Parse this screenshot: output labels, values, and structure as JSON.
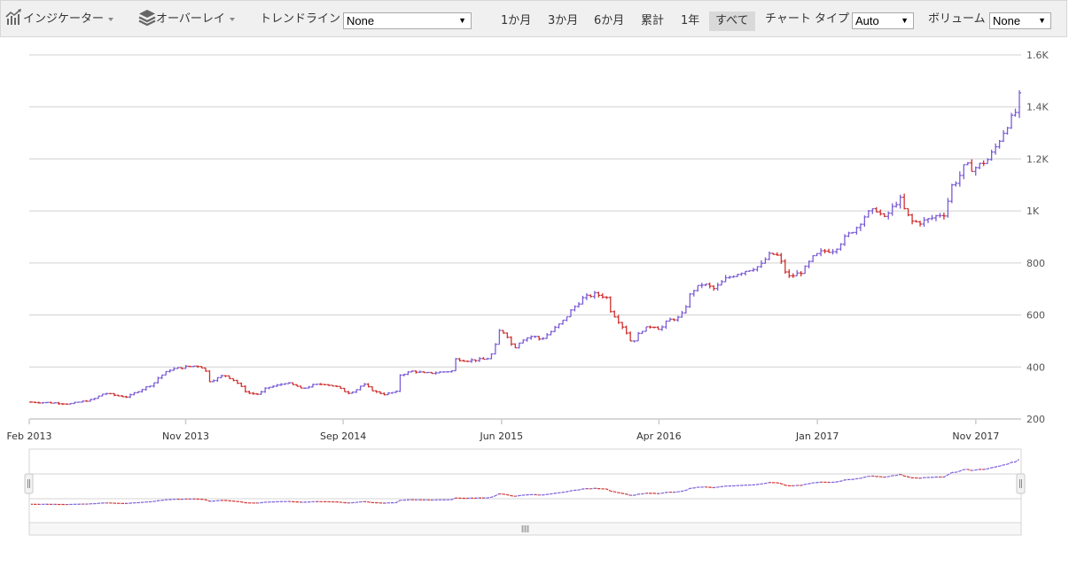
{
  "toolbar": {
    "indicator_label": "インジケーター",
    "overlay_label": "オーバーレイ",
    "trendline_label": "トレンドライン",
    "trendline_value": "None",
    "ranges": [
      {
        "label": "1か月",
        "active": false
      },
      {
        "label": "3か月",
        "active": false
      },
      {
        "label": "6か月",
        "active": false
      },
      {
        "label": "累計",
        "active": false
      },
      {
        "label": "1年",
        "active": false
      },
      {
        "label": "すべて",
        "active": true
      }
    ],
    "chart_type_label": "チャート タイプ",
    "chart_type_value": "Auto",
    "volume_label": "ボリューム",
    "volume_value": "None"
  },
  "colors": {
    "up": "#7b5cd6",
    "down": "#d03030",
    "grid": "#d0d0d0"
  },
  "chart_data": {
    "type": "ohlc",
    "title": "",
    "xlabel": "",
    "ylabel": "",
    "ylim": [
      200,
      1600
    ],
    "y_ticks": [
      {
        "value": 200,
        "label": "200"
      },
      {
        "value": 400,
        "label": "400"
      },
      {
        "value": 600,
        "label": "600"
      },
      {
        "value": 800,
        "label": "800"
      },
      {
        "value": 1000,
        "label": "1K"
      },
      {
        "value": 1200,
        "label": "1.2K"
      },
      {
        "value": 1400,
        "label": "1.4K"
      },
      {
        "value": 1600,
        "label": "1.6K"
      }
    ],
    "x_range": [
      "2013-02",
      "2018-01"
    ],
    "x_ticks": [
      {
        "pos": 0.0,
        "label": "Feb 2013"
      },
      {
        "pos": 0.158,
        "label": "Nov 2013"
      },
      {
        "pos": 0.317,
        "label": "Sep 2014"
      },
      {
        "pos": 0.477,
        "label": "Jun 2015"
      },
      {
        "pos": 0.636,
        "label": "Apr 2016"
      },
      {
        "pos": 0.796,
        "label": "Jan 2017"
      },
      {
        "pos": 0.956,
        "label": "Nov 2017"
      }
    ],
    "grid": true,
    "series_waypoints": [
      [
        0.0,
        265
      ],
      [
        0.03,
        262
      ],
      [
        0.05,
        258
      ],
      [
        0.08,
        275
      ],
      [
        0.095,
        300
      ],
      [
        0.11,
        290
      ],
      [
        0.125,
        285
      ],
      [
        0.14,
        310
      ],
      [
        0.158,
        335
      ],
      [
        0.165,
        360
      ],
      [
        0.18,
        390
      ],
      [
        0.2,
        400
      ],
      [
        0.215,
        405
      ],
      [
        0.225,
        395
      ],
      [
        0.23,
        345
      ],
      [
        0.24,
        355
      ],
      [
        0.25,
        370
      ],
      [
        0.265,
        345
      ],
      [
        0.28,
        300
      ],
      [
        0.295,
        295
      ],
      [
        0.305,
        320
      ],
      [
        0.32,
        330
      ],
      [
        0.33,
        340
      ],
      [
        0.345,
        325
      ],
      [
        0.35,
        315
      ],
      [
        0.365,
        330
      ],
      [
        0.38,
        335
      ],
      [
        0.395,
        325
      ],
      [
        0.41,
        300
      ],
      [
        0.42,
        310
      ],
      [
        0.43,
        335
      ],
      [
        0.445,
        305
      ],
      [
        0.458,
        295
      ],
      [
        0.465,
        300
      ],
      [
        0.475,
        305
      ],
      [
        0.478,
        370
      ],
      [
        0.495,
        385
      ],
      [
        0.51,
        375
      ],
      [
        0.53,
        380
      ],
      [
        0.545,
        385
      ],
      [
        0.55,
        430
      ],
      [
        0.565,
        425
      ],
      [
        0.59,
        430
      ],
      [
        0.6,
        460
      ],
      [
        0.605,
        540
      ],
      [
        0.615,
        530
      ],
      [
        0.625,
        470
      ],
      [
        0.635,
        505
      ],
      [
        0.65,
        520
      ],
      [
        0.66,
        505
      ],
      [
        0.675,
        540
      ],
      [
        0.69,
        580
      ],
      [
        0.7,
        620
      ],
      [
        0.715,
        665
      ],
      [
        0.73,
        680
      ],
      [
        0.745,
        670
      ],
      [
        0.75,
        620
      ],
      [
        0.76,
        580
      ],
      [
        0.77,
        540
      ],
      [
        0.778,
        490
      ],
      [
        0.79,
        540
      ],
      [
        0.805,
        560
      ],
      [
        0.815,
        545
      ],
      [
        0.825,
        580
      ],
      [
        0.84,
        590
      ],
      [
        0.845,
        610
      ],
      [
        0.855,
        690
      ],
      [
        0.87,
        720
      ],
      [
        0.885,
        700
      ],
      [
        0.9,
        740
      ],
      [
        0.915,
        760
      ],
      [
        0.93,
        775
      ],
      [
        0.945,
        790
      ],
      [
        0.955,
        830
      ],
      [
        0.965,
        835
      ],
      [
        0.972,
        800
      ],
      [
        0.98,
        745
      ],
      [
        0.99,
        755
      ],
      [
        1.0,
        770
      ],
      [
        1.012,
        820
      ],
      [
        1.025,
        845
      ],
      [
        1.04,
        850
      ],
      [
        1.055,
        900
      ],
      [
        1.07,
        940
      ],
      [
        1.082,
        990
      ],
      [
        1.095,
        1005
      ],
      [
        1.105,
        970
      ],
      [
        1.115,
        1010
      ],
      [
        1.125,
        1050
      ],
      [
        1.13,
        1010
      ],
      [
        1.14,
        960
      ],
      [
        1.15,
        955
      ],
      [
        1.165,
        970
      ],
      [
        1.175,
        985
      ],
      [
        1.185,
        990
      ],
      [
        1.19,
        1090
      ],
      [
        1.2,
        1120
      ],
      [
        1.21,
        1180
      ],
      [
        1.22,
        1160
      ],
      [
        1.23,
        1180
      ],
      [
        1.24,
        1200
      ],
      [
        1.25,
        1250
      ],
      [
        1.262,
        1320
      ],
      [
        1.275,
        1380
      ],
      [
        1.28,
        1440
      ]
    ]
  }
}
